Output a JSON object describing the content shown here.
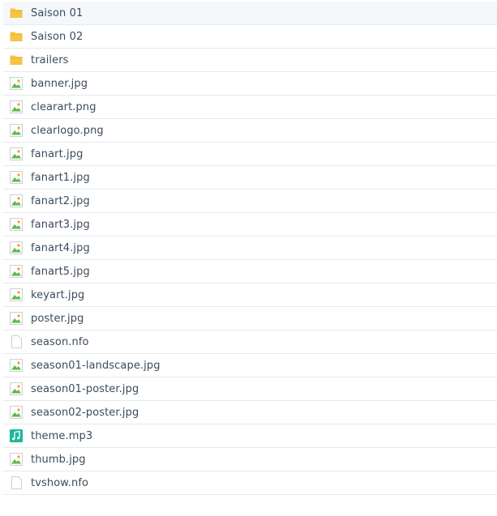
{
  "files": [
    {
      "name": "Saison 01",
      "type": "folder"
    },
    {
      "name": "Saison 02",
      "type": "folder"
    },
    {
      "name": "trailers",
      "type": "folder"
    },
    {
      "name": "banner.jpg",
      "type": "image"
    },
    {
      "name": "clearart.png",
      "type": "image"
    },
    {
      "name": "clearlogo.png",
      "type": "image"
    },
    {
      "name": "fanart.jpg",
      "type": "image"
    },
    {
      "name": "fanart1.jpg",
      "type": "image"
    },
    {
      "name": "fanart2.jpg",
      "type": "image"
    },
    {
      "name": "fanart3.jpg",
      "type": "image"
    },
    {
      "name": "fanart4.jpg",
      "type": "image"
    },
    {
      "name": "fanart5.jpg",
      "type": "image"
    },
    {
      "name": "keyart.jpg",
      "type": "image"
    },
    {
      "name": "poster.jpg",
      "type": "image"
    },
    {
      "name": "season.nfo",
      "type": "document"
    },
    {
      "name": "season01-landscape.jpg",
      "type": "image"
    },
    {
      "name": "season01-poster.jpg",
      "type": "image"
    },
    {
      "name": "season02-poster.jpg",
      "type": "image"
    },
    {
      "name": "theme.mp3",
      "type": "audio"
    },
    {
      "name": "thumb.jpg",
      "type": "image"
    },
    {
      "name": "tvshow.nfo",
      "type": "document"
    }
  ],
  "icons": {
    "folder": "folder-icon",
    "image": "image-file-icon",
    "document": "document-file-icon",
    "audio": "audio-file-icon"
  },
  "colors": {
    "folder": "#f6c344",
    "audio": "#1fb89a",
    "image_green": "#5dbb46",
    "image_orange": "#f39c34",
    "text": "#3b4b5c",
    "divider": "#e6e9ed"
  }
}
